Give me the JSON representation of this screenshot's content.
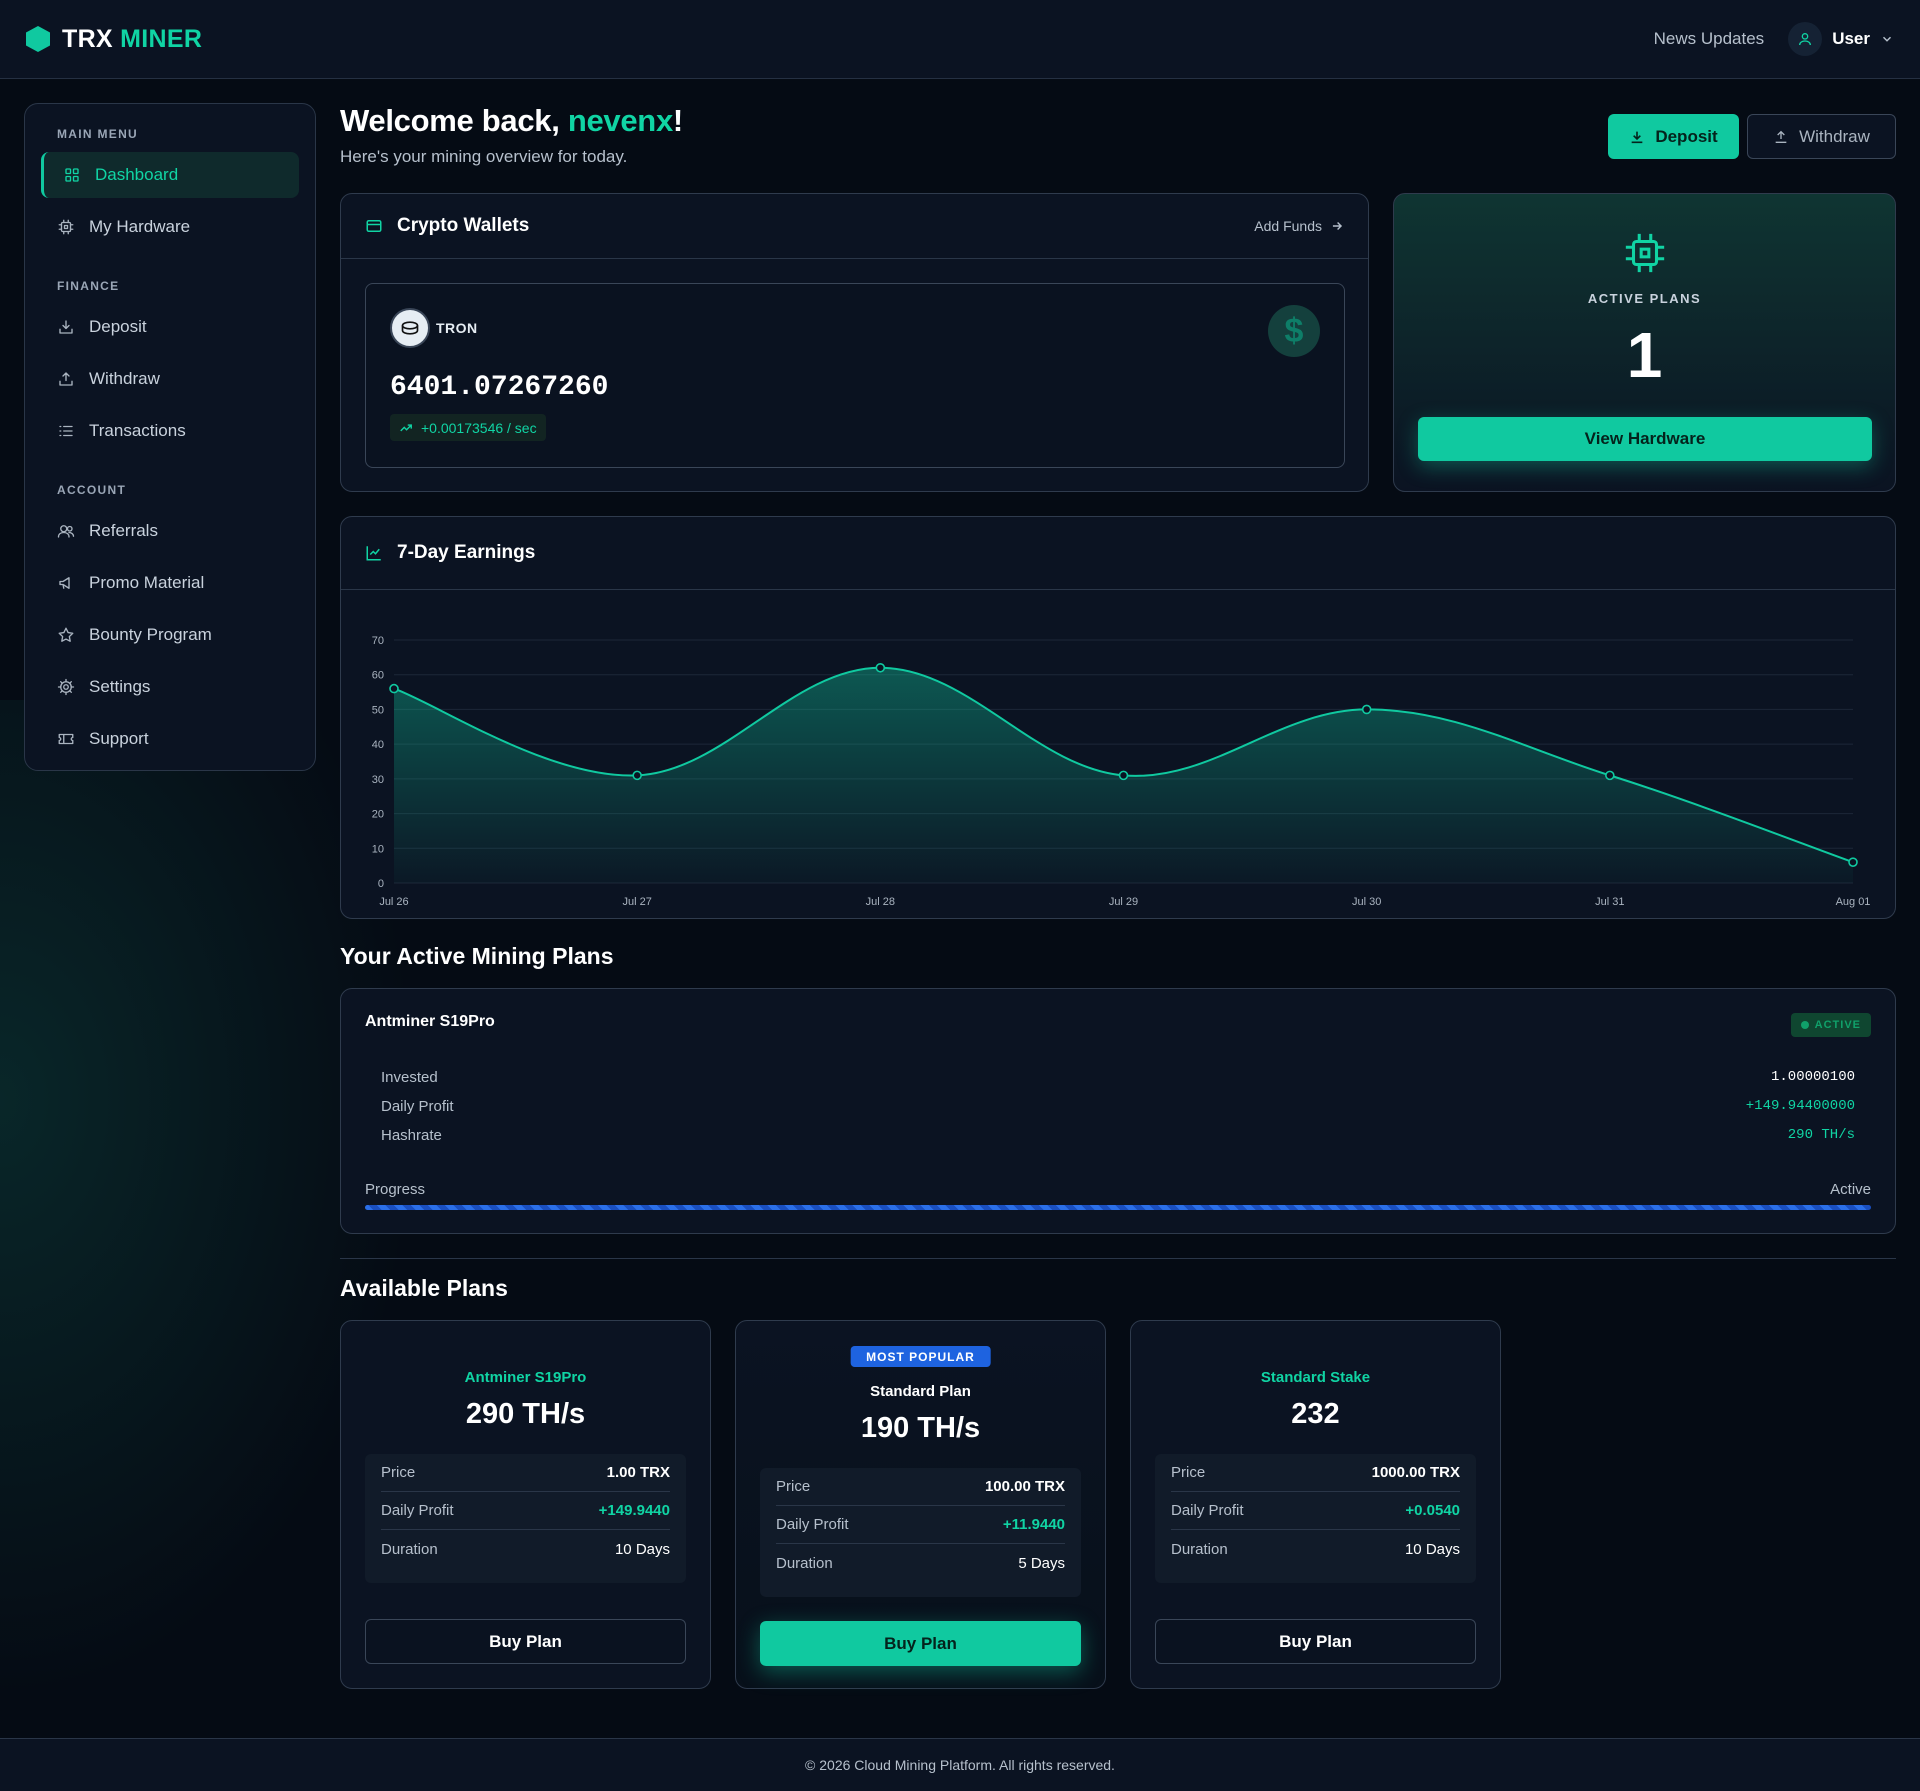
{
  "brand": {
    "name_white": "TRX",
    "name_green": "MINER"
  },
  "header": {
    "news_label": "News Updates",
    "user_label": "User"
  },
  "sidebar": {
    "sections": [
      {
        "title": "MAIN MENU",
        "items": [
          {
            "label": "Dashboard",
            "icon": "grid-icon",
            "active": true
          },
          {
            "label": "My Hardware",
            "icon": "cpu-icon"
          }
        ]
      },
      {
        "title": "FINANCE",
        "items": [
          {
            "label": "Deposit",
            "icon": "download-icon"
          },
          {
            "label": "Withdraw",
            "icon": "upload-icon"
          },
          {
            "label": "Transactions",
            "icon": "list-icon"
          }
        ]
      },
      {
        "title": "ACCOUNT",
        "items": [
          {
            "label": "Referrals",
            "icon": "users-icon"
          },
          {
            "label": "Promo Material",
            "icon": "megaphone-icon"
          },
          {
            "label": "Bounty Program",
            "icon": "star-icon"
          },
          {
            "label": "Settings",
            "icon": "gear-icon"
          },
          {
            "label": "Support",
            "icon": "ticket-icon"
          }
        ]
      }
    ]
  },
  "welcome": {
    "prefix": "Welcome back, ",
    "name": "nevenx",
    "suffix": "!",
    "subtitle": "Here's your mining overview for today."
  },
  "actions": {
    "deposit": "Deposit",
    "withdraw": "Withdraw"
  },
  "wallets": {
    "title": "Crypto Wallets",
    "add_funds": "Add Funds",
    "coin": "TRON",
    "coin_symbol": "$",
    "balance": "6401.07267260",
    "rate": "+0.00173546 / sec"
  },
  "active_plans": {
    "label": "ACTIVE PLANS",
    "count": "1",
    "button": "View Hardware"
  },
  "earnings": {
    "title": "7-Day Earnings"
  },
  "chart_data": {
    "type": "area",
    "title": "7-Day Earnings",
    "categories": [
      "Jul 26",
      "Jul 27",
      "Jul 28",
      "Jul 29",
      "Jul 30",
      "Jul 31",
      "Aug 01"
    ],
    "values": [
      56,
      31,
      62,
      31,
      50,
      31,
      6
    ],
    "ylim": [
      0,
      70
    ],
    "yticks": [
      0,
      10,
      20,
      30,
      40,
      50,
      60,
      70
    ],
    "grid": true,
    "color": "#10c9a0"
  },
  "mining": {
    "section_title": "Your Active Mining Plans",
    "plan": {
      "name": "Antminer S19Pro",
      "status": "ACTIVE",
      "rows": [
        {
          "label": "Invested",
          "value": "1.00000100",
          "color": "#ffffff"
        },
        {
          "label": "Daily Profit",
          "value": "+149.94400000",
          "color": "#10d4a4"
        },
        {
          "label": "Hashrate",
          "value": "290 TH/s",
          "color": "#10d4a4"
        }
      ],
      "progress_label": "Progress",
      "progress_status": "Active",
      "progress": 1.0
    }
  },
  "available": {
    "section_title": "Available Plans",
    "plans": [
      {
        "name": "Antminer S19Pro",
        "hashrate": "290 TH/s",
        "price": "1.00 TRX",
        "daily": "+149.9440",
        "duration": "10 Days",
        "popular": false,
        "button": "Buy Plan"
      },
      {
        "name": "Standard Plan",
        "hashrate": "190 TH/s",
        "price": "100.00 TRX",
        "daily": "+11.9440",
        "duration": "5 Days",
        "popular": true,
        "badge": "MOST POPULAR",
        "button": "Buy Plan"
      },
      {
        "name": "Standard Stake",
        "hashrate": "232",
        "price": "1000.00 TRX",
        "daily": "+0.0540",
        "duration": "10 Days",
        "popular": false,
        "button": "Buy Plan"
      }
    ],
    "labels": {
      "price": "Price",
      "daily": "Daily Profit",
      "duration": "Duration"
    }
  },
  "footer": {
    "text": "© 2026 Cloud Mining Platform. All rights reserved."
  }
}
